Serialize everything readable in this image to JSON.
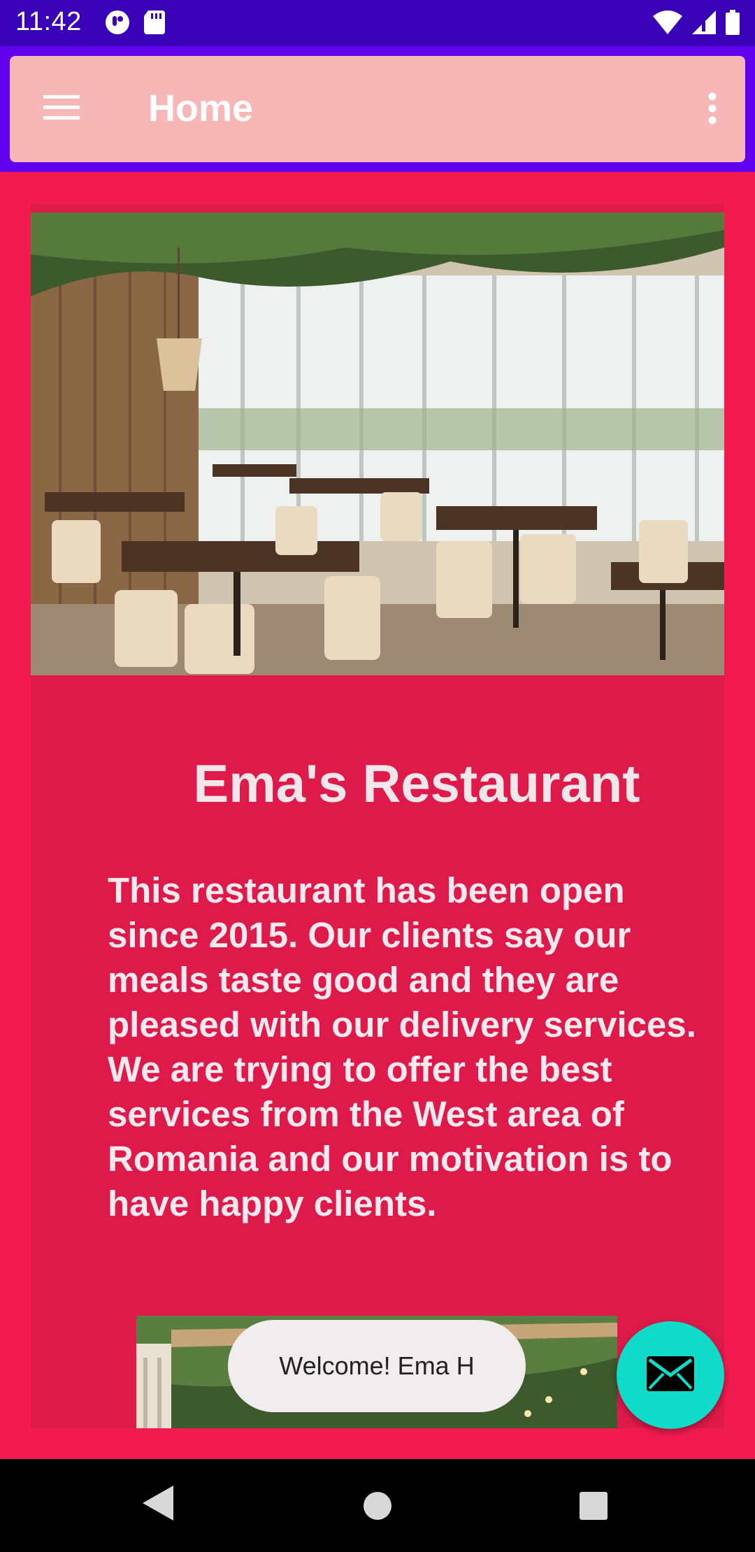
{
  "status_bar": {
    "time": "11:42",
    "left_icons": [
      "notification-app-icon",
      "sd-card-icon"
    ],
    "right_icons": [
      "wifi-icon",
      "cell-signal-icon",
      "battery-icon"
    ]
  },
  "app_bar": {
    "title": "Home",
    "nav_icon": "hamburger-menu-icon",
    "action_icon": "overflow-menu-icon"
  },
  "content": {
    "hero_image": "restaurant-interior-photo",
    "restaurant_name": "Ema's Restaurant",
    "description": "This restaurant has been open since 2015. Our clients say our meals taste good and they are pleased with our delivery services. We are trying to offer the best services from the West area of Romania and our motivation is to have happy clients.",
    "second_image": "restaurant-ceiling-lights-photo"
  },
  "toast": {
    "message": "Welcome! Ema H"
  },
  "fab": {
    "icon": "email-icon"
  },
  "nav_bar": {
    "buttons": [
      "back-icon",
      "home-icon",
      "recents-icon"
    ]
  },
  "colors": {
    "status_bar": "#3a02b7",
    "app_bar_frame": "#6200ee",
    "app_bar": "#f7b7b7",
    "background": "#f21b4f",
    "card": "#de1a4a",
    "fab": "#10dbc9"
  }
}
